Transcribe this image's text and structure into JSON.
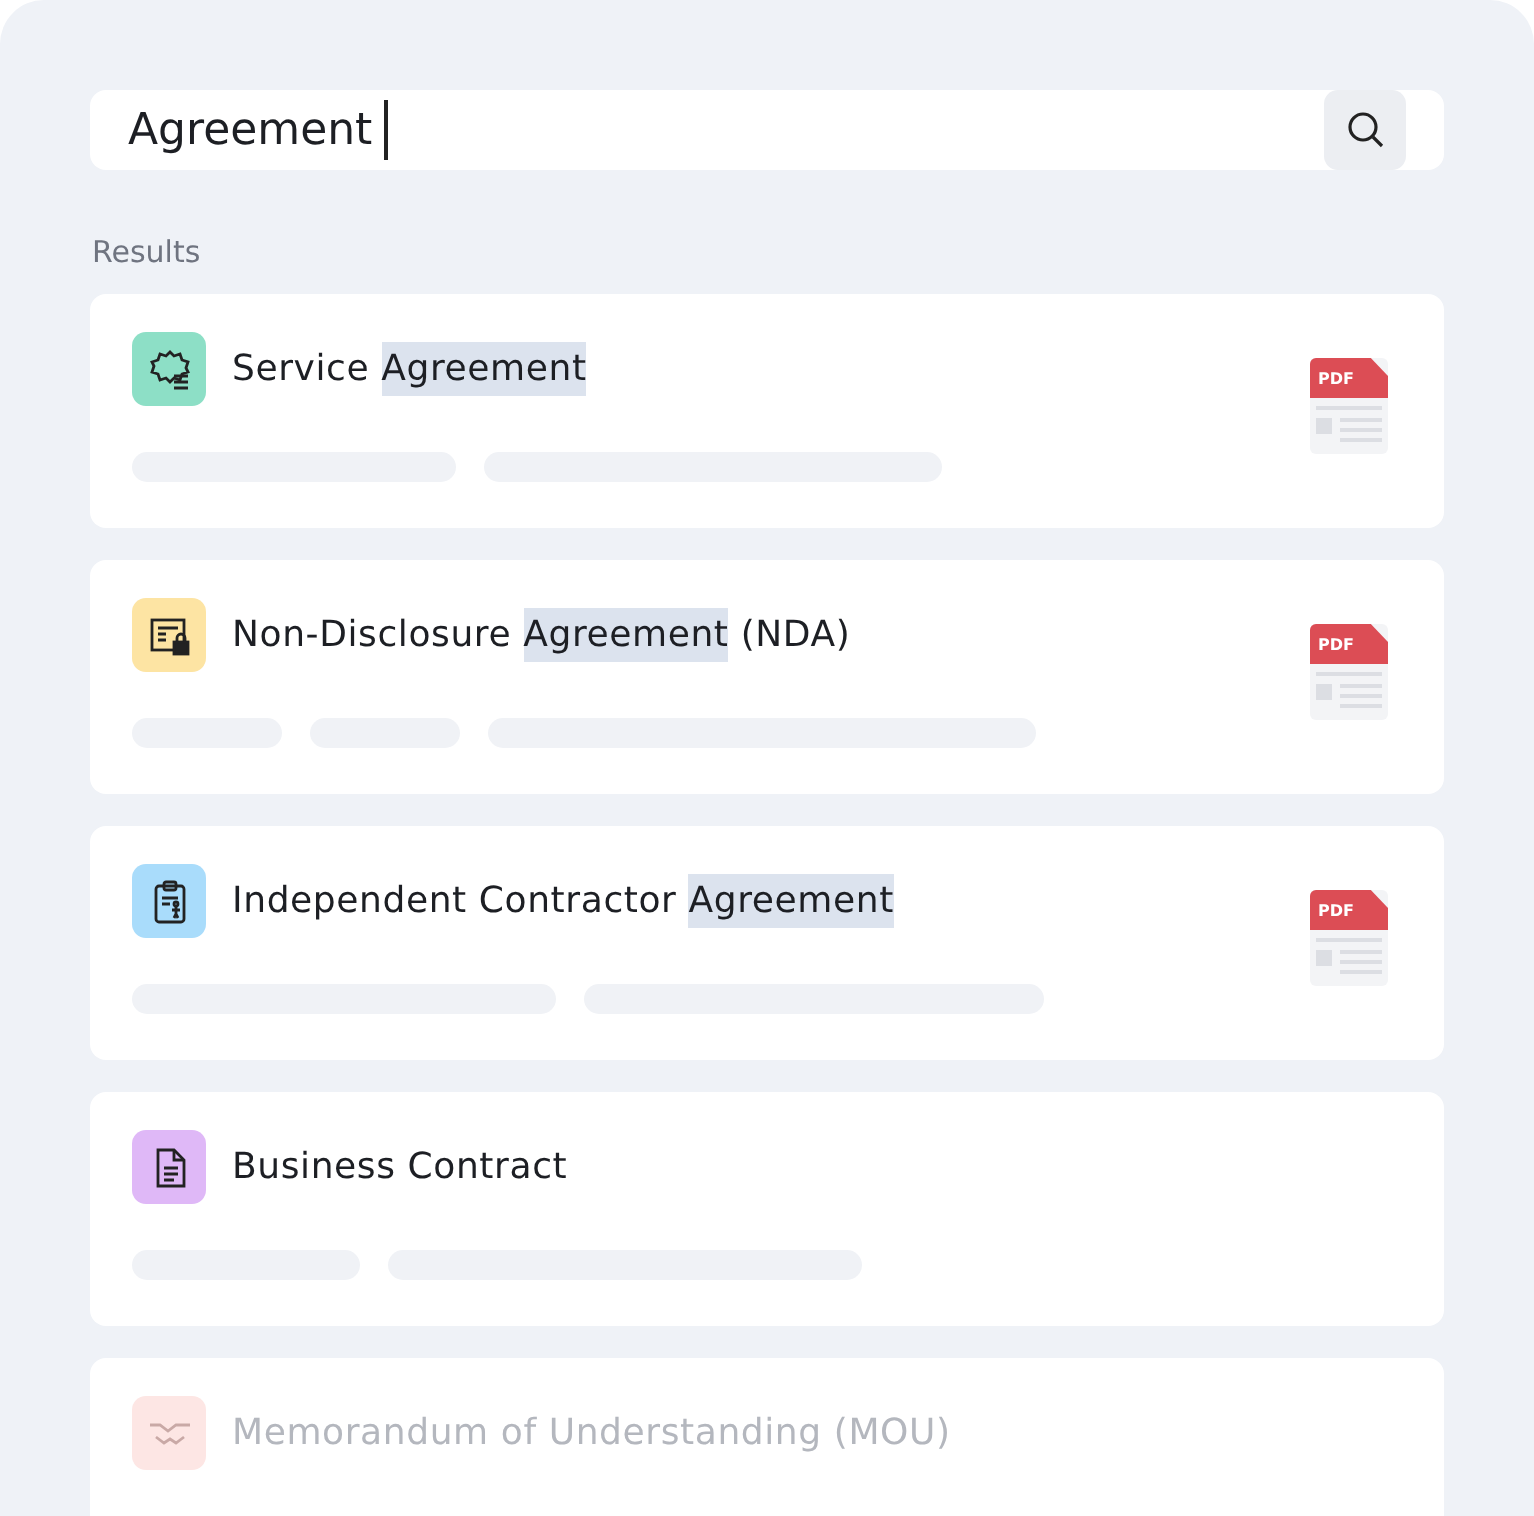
{
  "search": {
    "value": "Agreement"
  },
  "results_label": "Results",
  "results": [
    {
      "title": [
        {
          "text": "Service ",
          "highlighted": false
        },
        {
          "text": "Agreement",
          "highlighted": true
        }
      ],
      "color": "#8ddfc6",
      "file_badge": "PDF",
      "faded": false
    },
    {
      "title": [
        {
          "text": "Non-Disclosure ",
          "highlighted": false
        },
        {
          "text": "Agreement",
          "highlighted": true
        },
        {
          "text": " (NDA)",
          "highlighted": false
        }
      ],
      "color": "#fde4a3",
      "file_badge": "PDF",
      "faded": false
    },
    {
      "title": [
        {
          "text": "Independent Contractor ",
          "highlighted": false
        },
        {
          "text": "Agreement",
          "highlighted": true
        }
      ],
      "color": "#a9dcfb",
      "file_badge": "PDF",
      "faded": false
    },
    {
      "title": [
        {
          "text": "Business Contract",
          "highlighted": false
        }
      ],
      "color": "#dfb8f7",
      "faded": false
    },
    {
      "title": [
        {
          "text": "Memorandum of Understanding (MOU)",
          "highlighted": false
        }
      ],
      "color": "#fde6e4",
      "faded": true
    }
  ]
}
